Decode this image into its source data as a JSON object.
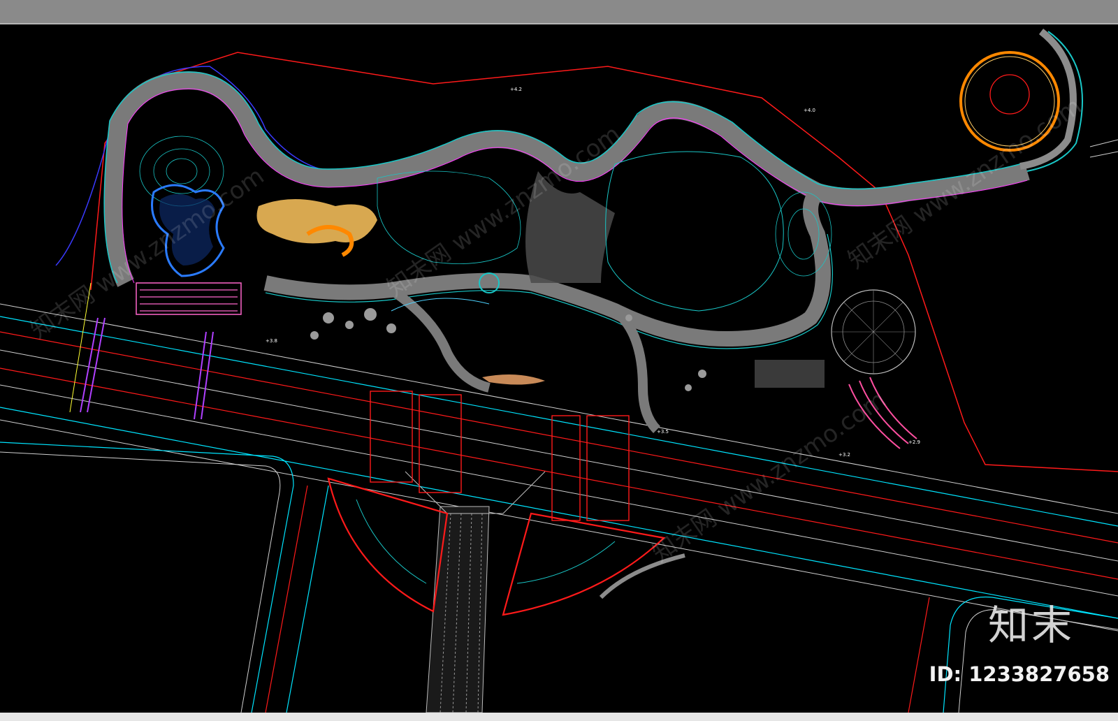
{
  "colors": {
    "background": "#000000",
    "boundary": "#ff1a1a",
    "road": "#00e5ff",
    "path": "#8c8c8c",
    "contour": "#19c7c7",
    "plaza": "#ff66cc",
    "sand": "#ffcc66",
    "orange": "#ff8800",
    "pink": "#ff4fa0"
  },
  "watermark": {
    "logo": "知末",
    "id": "ID: 1233827658",
    "site": "知末网 www.znzmo.com"
  }
}
